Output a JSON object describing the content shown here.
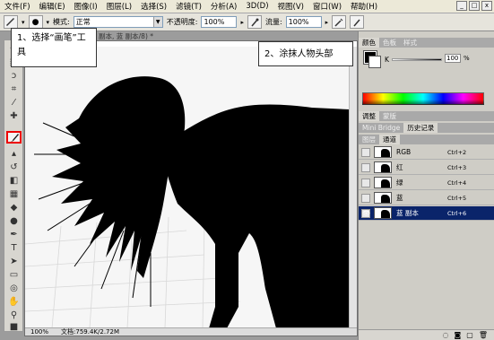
{
  "menu": [
    "文件(F)",
    "编辑(E)",
    "图像(I)",
    "图层(L)",
    "选择(S)",
    "滤镜(T)",
    "分析(A)",
    "3D(D)",
    "视图(V)",
    "窗口(W)",
    "帮助(H)"
  ],
  "window_buttons": [
    "_",
    "□",
    "x"
  ],
  "options": {
    "brush_size": "●",
    "mode_label": "模式:",
    "mode_value": "正常",
    "opacity_label": "不透明度:",
    "opacity_value": "100%",
    "flow_label": "流量:",
    "flow_value": "100%"
  },
  "document": {
    "tab_title": "副本, 蓝 副本/8) *",
    "close": "x",
    "zoom": "100%",
    "doc_size": "文档:759.4K/2.72M"
  },
  "callouts": {
    "step1": "1、选择“画笔”工具",
    "step2": "2、涂抹人物头部"
  },
  "panels": {
    "top_tabs": [
      "颜色",
      "色板",
      "样式"
    ],
    "k_label": "K",
    "k_value": "100",
    "k_unit": "%",
    "mid_tabs": [
      "调整",
      "蒙版"
    ],
    "mid_tabs2": [
      "Mini Bridge",
      "历史记录"
    ],
    "chan_tabs": [
      "图层",
      "通道"
    ]
  },
  "channels": [
    {
      "name": "RGB",
      "shortcut": "Ctrl+2"
    },
    {
      "name": "红",
      "shortcut": "Ctrl+3"
    },
    {
      "name": "绿",
      "shortcut": "Ctrl+4"
    },
    {
      "name": "蓝",
      "shortcut": "Ctrl+5"
    },
    {
      "name": "蓝 副本",
      "shortcut": "Ctrl+6"
    }
  ],
  "colors": {
    "selected_channel": "#0a246a",
    "highlight_box": "#e00000",
    "foreground": "#000000"
  },
  "icons": [
    "brush-tool-icon",
    "move-tool-icon",
    "marquee-tool-icon",
    "lasso-tool-icon",
    "crop-tool-icon",
    "eyedropper-tool-icon",
    "healing-tool-icon",
    "stamp-tool-icon",
    "history-brush-icon",
    "eraser-tool-icon",
    "gradient-tool-icon",
    "blur-tool-icon",
    "dodge-tool-icon",
    "pen-tool-icon",
    "type-tool-icon",
    "path-select-icon",
    "shape-tool-icon",
    "hand-tool-icon",
    "zoom-tool-icon",
    "eye-icon"
  ]
}
